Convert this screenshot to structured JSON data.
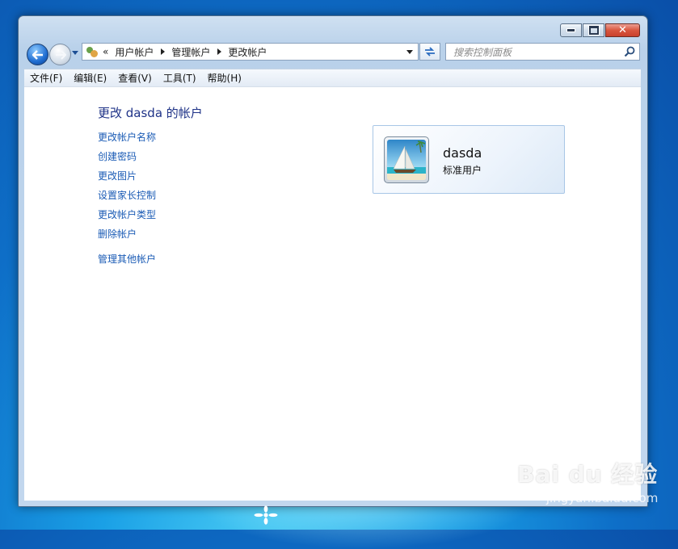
{
  "window": {
    "breadcrumb": [
      "用户帐户",
      "管理帐户",
      "更改帐户"
    ],
    "overflow_chevron": "«",
    "search_placeholder": "搜索控制面板",
    "close_glyph": "✕"
  },
  "menu": [
    "文件(F)",
    "编辑(E)",
    "查看(V)",
    "工具(T)",
    "帮助(H)"
  ],
  "page": {
    "title": "更改 dasda 的帐户",
    "tasks": [
      "更改帐户名称",
      "创建密码",
      "更改图片",
      "设置家长控制",
      "更改帐户类型",
      "删除帐户"
    ],
    "other_link": "管理其他帐户"
  },
  "account": {
    "name": "dasda",
    "type": "标准用户",
    "picture_icon": "sailboat-beach-picture"
  },
  "watermark": {
    "brand": "Bai du 经验",
    "url": "jingyan.baidu.com"
  },
  "colors": {
    "link": "#1a5bb5",
    "title": "#1e3287",
    "close_button": "#d9563f"
  }
}
